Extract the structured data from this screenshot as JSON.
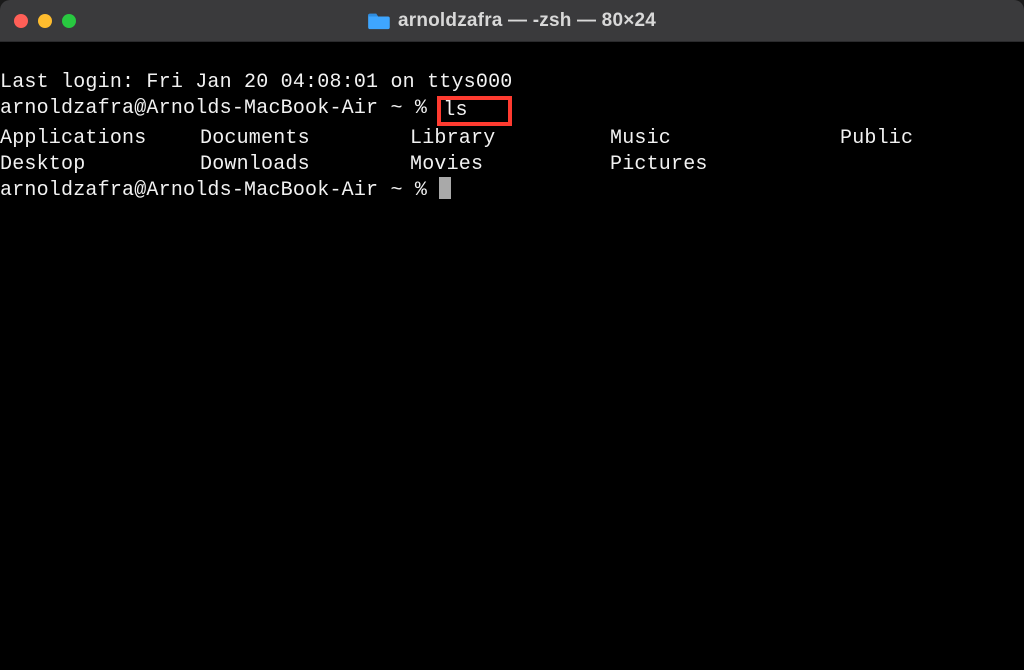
{
  "titlebar": {
    "title": "arnoldzafra — -zsh — 80×24"
  },
  "terminal": {
    "last_login": "Last login: Fri Jan 20 04:08:01 on ttys000",
    "prompt1_prefix": "arnoldzafra@Arnolds-MacBook-Air ~ % ",
    "command1": "ls",
    "listing": {
      "col1": [
        "Applications",
        "Desktop"
      ],
      "col2": [
        "Documents",
        "Downloads"
      ],
      "col3": [
        "Library",
        "Movies"
      ],
      "col4": [
        "Music",
        "Pictures"
      ],
      "col5": [
        "Public",
        ""
      ]
    },
    "prompt2": "arnoldzafra@Arnolds-MacBook-Air ~ % "
  }
}
